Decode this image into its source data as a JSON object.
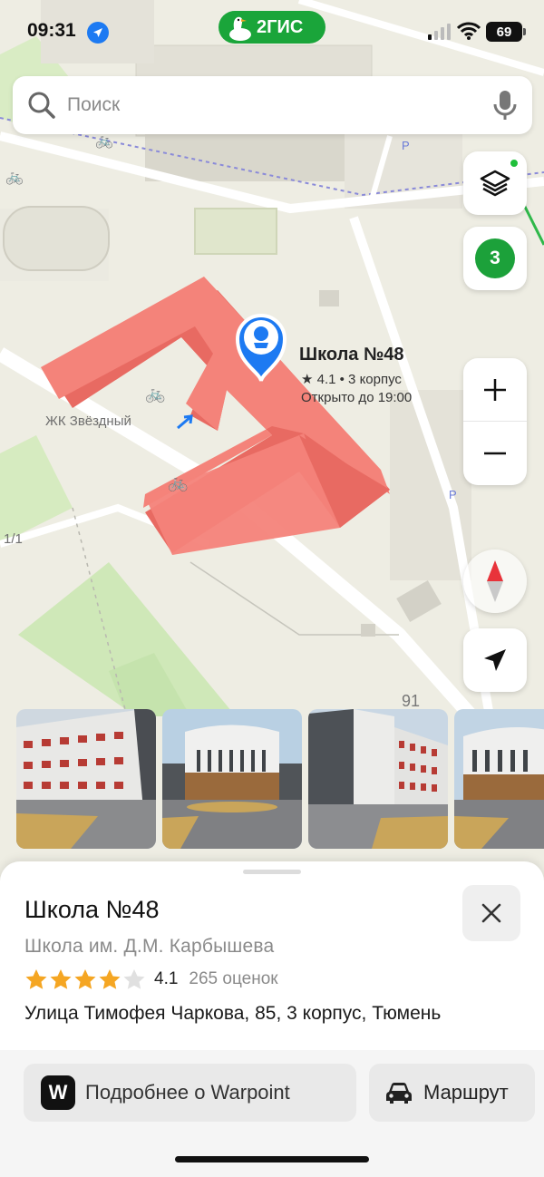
{
  "status_bar": {
    "time": "09:31",
    "battery": "69"
  },
  "brand": {
    "name": "2ГИС"
  },
  "search": {
    "placeholder": "Поиск",
    "value": ""
  },
  "map": {
    "poi": {
      "title": "Школа №48",
      "subtitle": "★ 4.1 • 3 корпус",
      "hours": "Открыто до 19:00"
    },
    "labels": {
      "complex": "ЖК Звёздный",
      "left_number": "1/1",
      "house_number": "91"
    },
    "traffic_score": "3",
    "colors": {
      "building": "#f4837a",
      "accent": "#1aa53a",
      "pin": "#1d7af2"
    }
  },
  "sheet": {
    "title": "Школа №48",
    "subtitle": "Школа им. Д.М. Карбышева",
    "rating": {
      "value": "4.1",
      "reviews": "265 оценок",
      "stars_filled": 4,
      "stars_total": 5
    },
    "address": "Улица Тимофея Чаркова, 85, 3 корпус, Тюмень",
    "buttons": {
      "warpoint": "Подробнее о Warpoint",
      "warpoint_logo": "W",
      "route": "Маршрут"
    }
  },
  "icons": [
    "location-arrow-icon",
    "signal-icon",
    "wifi-icon",
    "search-icon",
    "microphone-icon",
    "layers-icon",
    "plus-icon",
    "minus-icon",
    "compass-icon",
    "navigation-arrow-icon",
    "close-icon",
    "star-icon",
    "car-icon",
    "school-pin-icon"
  ]
}
